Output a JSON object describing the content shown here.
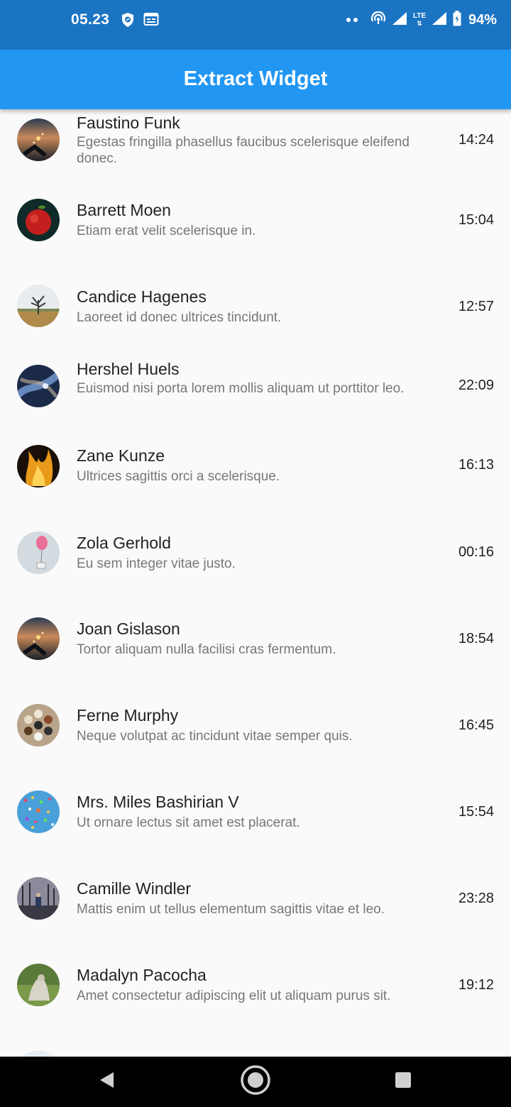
{
  "status_bar": {
    "time": "05.23",
    "left_icons": [
      "shield-icon",
      "calendar-card-icon"
    ],
    "right_icons": [
      "dots-icon",
      "hotspot-icon",
      "signal-icon",
      "lte-icon",
      "signal-icon",
      "battery-icon"
    ],
    "lte_text": "LTE",
    "battery_percent": "94%"
  },
  "app_bar": {
    "title": "Extract Widget",
    "color": "#2196f3"
  },
  "contacts": [
    {
      "name": "Faustino Funk",
      "message": "Egestas fringilla phasellus faucibus scelerisque eleifend donec.",
      "time": "14:24",
      "avatar": "dusk-sparkler-photo"
    },
    {
      "name": "Barrett Moen",
      "message": "Etiam erat velit scelerisque in.",
      "time": "15:04",
      "avatar": "red-apple-photo"
    },
    {
      "name": "Candice Hagenes",
      "message": "Laoreet id donec ultrices tincidunt.",
      "time": "12:57",
      "avatar": "bare-tree-field-photo"
    },
    {
      "name": "Hershel Huels",
      "message": "Euismod nisi porta lorem mollis aliquam ut porttitor leo.",
      "time": "22:09",
      "avatar": "blue-nebula-photo"
    },
    {
      "name": "Zane Kunze",
      "message": "Ultrices sagittis orci a scelerisque.",
      "time": "16:13",
      "avatar": "fire-flames-photo"
    },
    {
      "name": "Zola Gerhold",
      "message": "Eu sem integer vitae justo.",
      "time": "00:16",
      "avatar": "pink-balloon-photo"
    },
    {
      "name": "Joan Gislason",
      "message": "Tortor aliquam nulla facilisi cras fermentum.",
      "time": "18:54",
      "avatar": "dusk-sparkler-photo"
    },
    {
      "name": "Ferne Murphy",
      "message": "Neque volutpat ac tincidunt vitae semper quis.",
      "time": "16:45",
      "avatar": "spice-bowls-photo"
    },
    {
      "name": "Mrs. Miles Bashirian V",
      "message": "Ut ornare lectus sit amet est placerat.",
      "time": "15:54",
      "avatar": "colorful-dots-photo"
    },
    {
      "name": "Camille Windler",
      "message": "Mattis enim ut tellus elementum sagittis vitae et leo.",
      "time": "23:28",
      "avatar": "winter-trees-photo"
    },
    {
      "name": "Madalyn Pacocha",
      "message": "Amet consectetur adipiscing elit ut aliquam purus sit.",
      "time": "19:12",
      "avatar": "green-grass-photo"
    }
  ],
  "nav_bar": {
    "buttons": [
      "back-icon",
      "home-icon",
      "recents-icon"
    ]
  }
}
